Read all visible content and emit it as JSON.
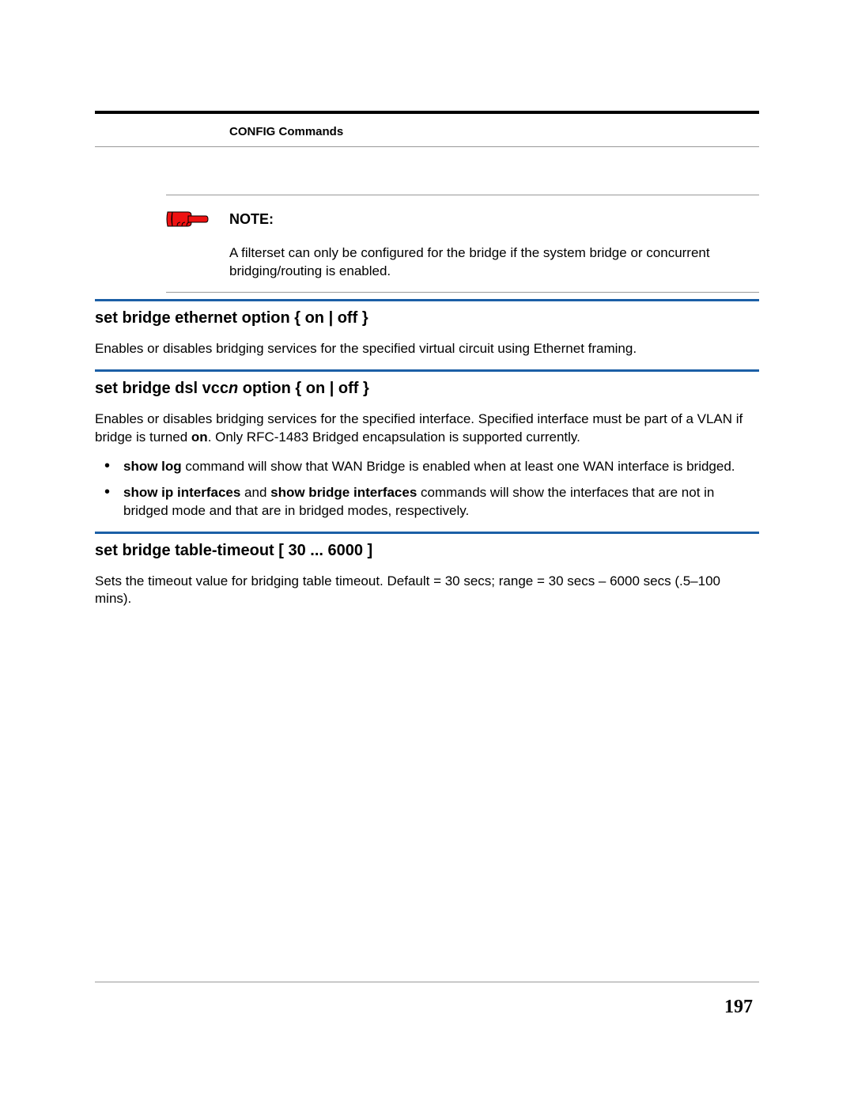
{
  "header": {
    "section_title": "CONFIG Commands"
  },
  "note": {
    "label": "NOTE:",
    "text": "A filterset can only be configured for the bridge if the system bridge or concurrent bridging/routing is enabled."
  },
  "sections": [
    {
      "heading_parts": {
        "pre": "set bridge ethernet option { on | off }",
        "italic": "",
        "post": ""
      },
      "body_html": "Enables or disables bridging services for the specified virtual circuit using Ethernet framing.",
      "bullets": []
    },
    {
      "heading_parts": {
        "pre": "set bridge dsl vcc",
        "italic": "n",
        "post": " option { on | off }"
      },
      "body_html": "Enables or disables bridging services for the specified interface. Specified interface must be part of a VLAN if bridge is turned <b>on</b>. Only RFC-1483 Bridged encapsulation is supported currently.",
      "bullets": [
        "<b>show log</b> command will show that WAN Bridge is enabled when at least one WAN interface is bridged.",
        "<b>show ip interfaces</b> and <b>show bridge interfaces</b> commands will show the interfaces that are not in bridged mode and that are in bridged modes, respectively."
      ]
    },
    {
      "heading_parts": {
        "pre": "set bridge table-timeout [ 30 ... 6000 ]",
        "italic": "",
        "post": ""
      },
      "body_html": "Sets the timeout value for bridging table timeout. Default = 30 secs; range = 30 secs – 6000 secs (.5–100 mins).",
      "bullets": []
    }
  ],
  "page_number": "197"
}
